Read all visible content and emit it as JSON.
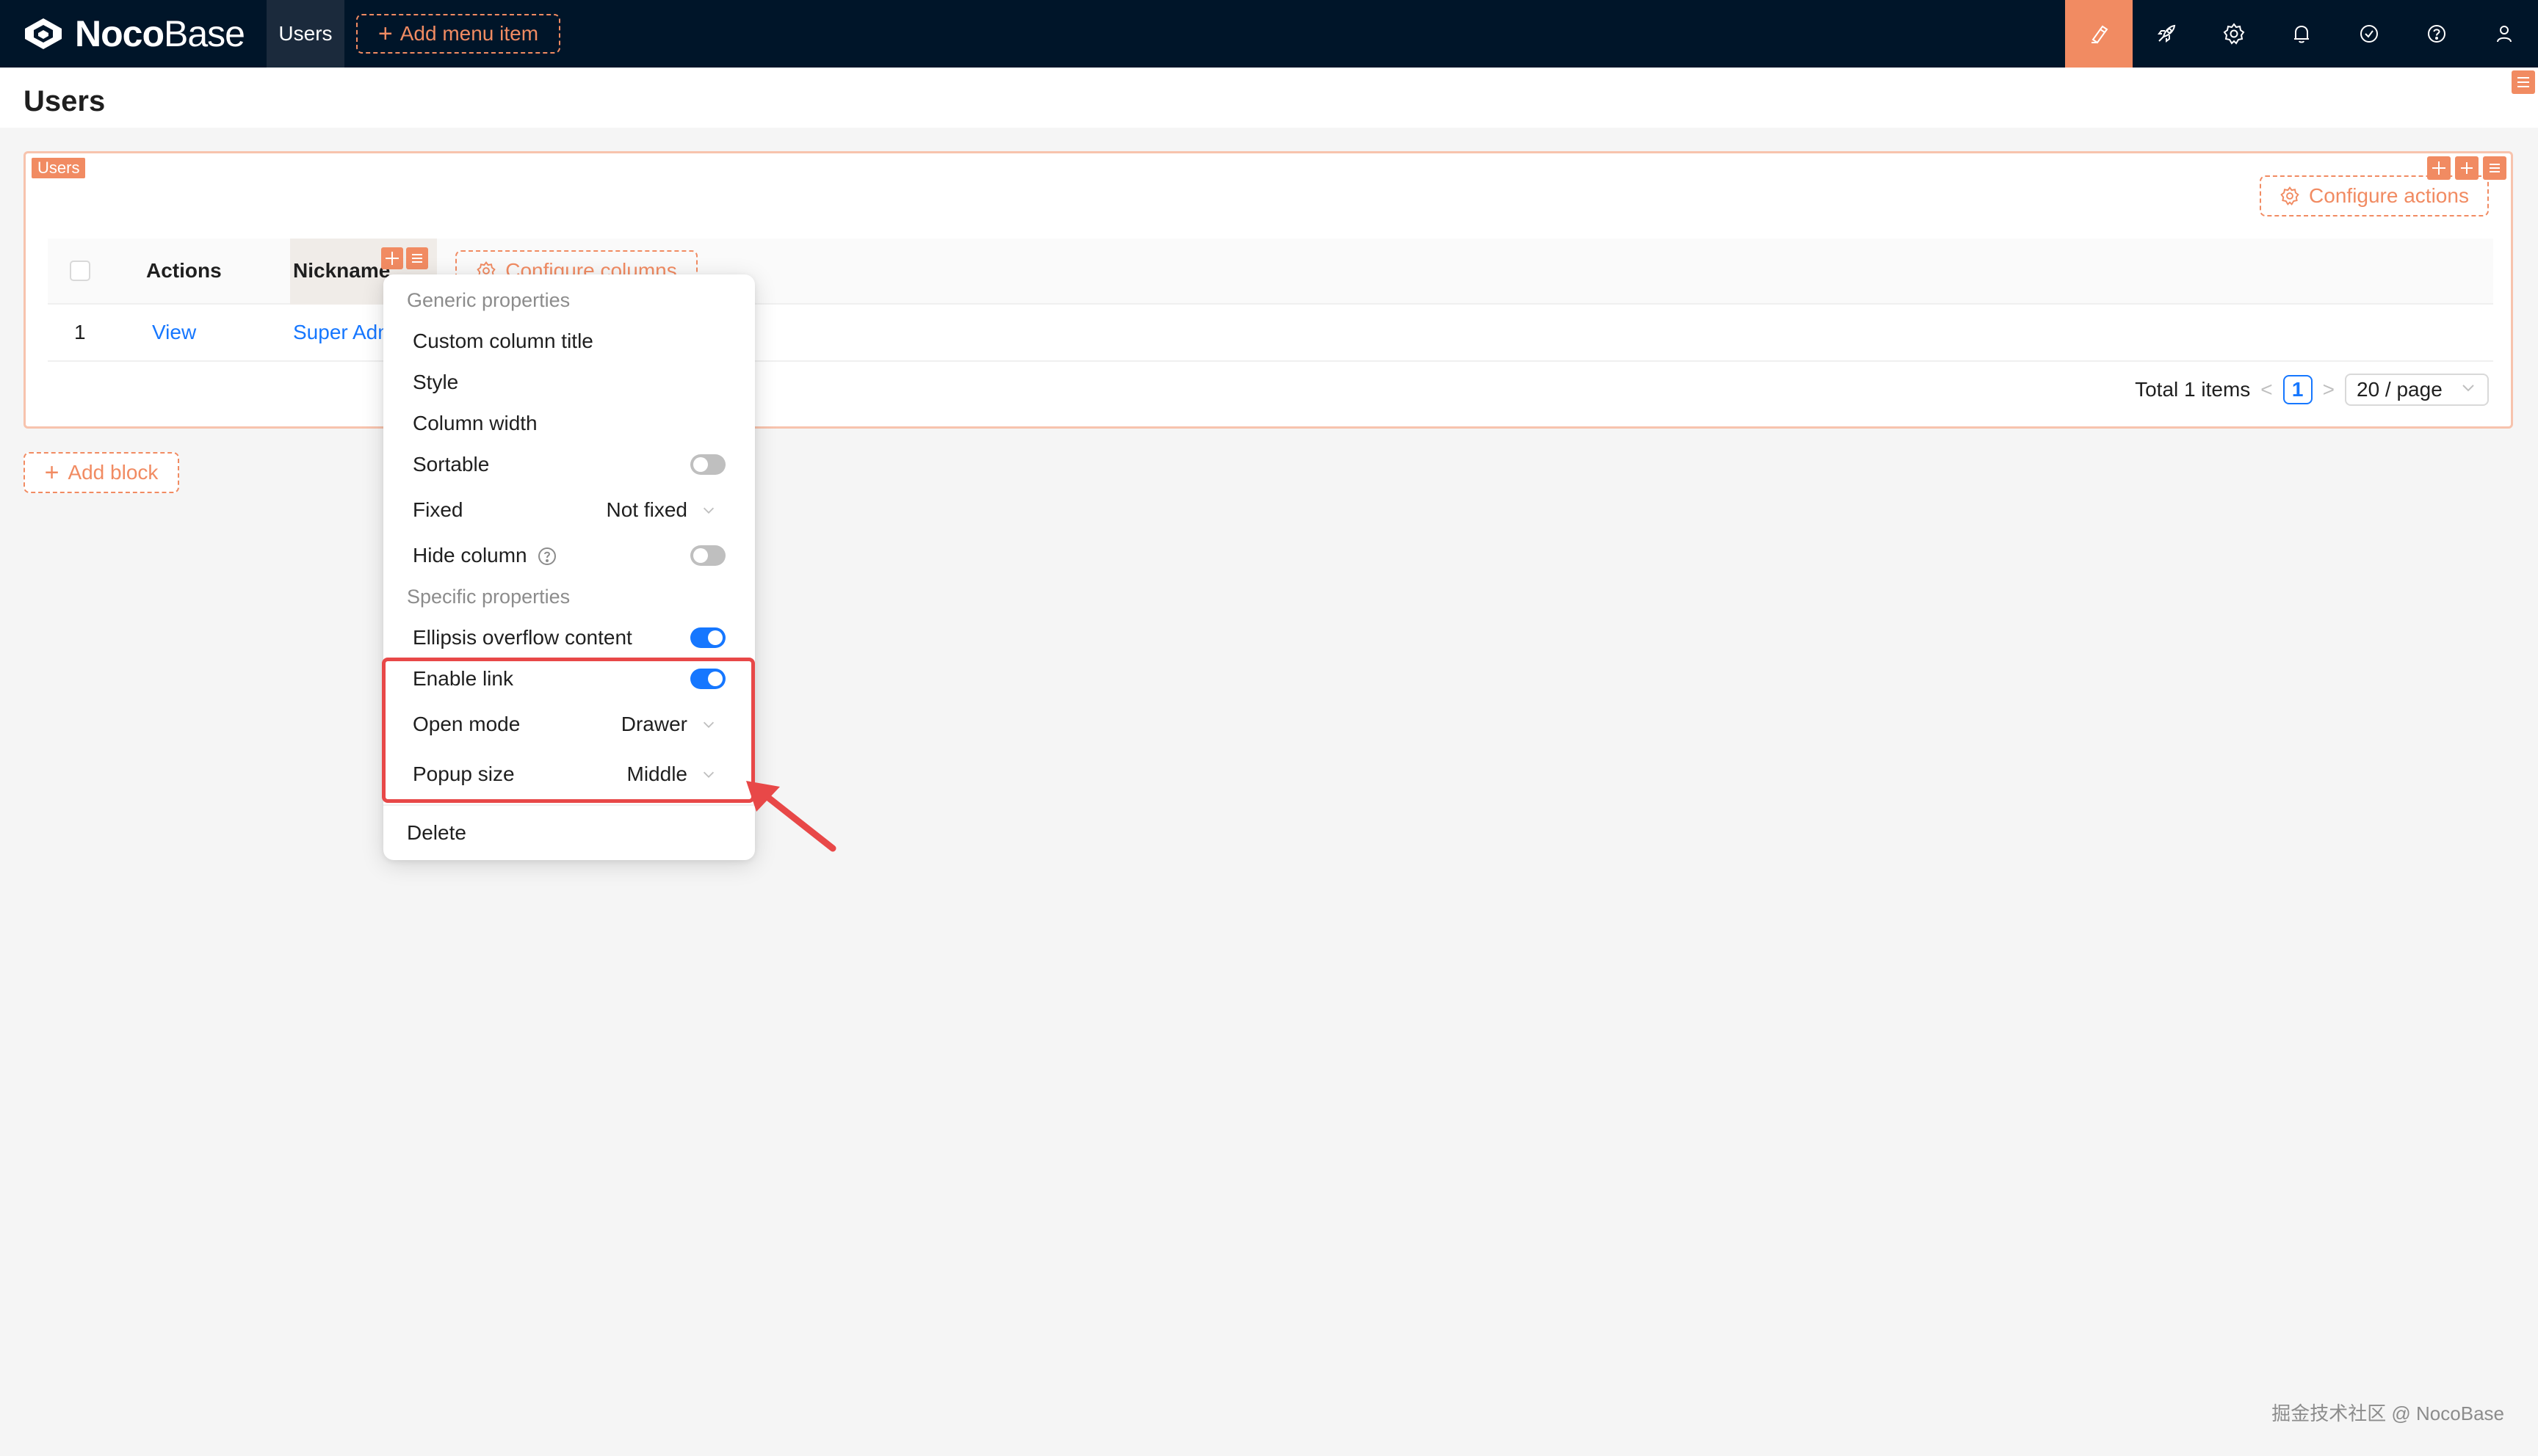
{
  "app": {
    "logo_strong": "Noco",
    "logo_light": "Base",
    "nav_item": "Users",
    "add_menu_item": "Add menu item"
  },
  "topbar_icons": [
    "design-brush-icon",
    "plugin-rocket-icon",
    "settings-gear-icon",
    "notification-bell-icon",
    "task-check-icon",
    "help-question-icon",
    "user-avatar-icon"
  ],
  "page": {
    "title": "Users"
  },
  "block": {
    "tag": "Users",
    "configure_actions": "Configure actions",
    "columns": {
      "actions": "Actions",
      "nickname": "Nickname"
    },
    "configure_columns": "Configure columns",
    "rows": [
      {
        "index": "1",
        "action": "View",
        "nickname": "Super Admir"
      }
    ],
    "pagination": {
      "total": "Total 1 items",
      "prev": "<",
      "current": "1",
      "next": ">",
      "page_size": "20 / page"
    }
  },
  "add_block": "Add block",
  "menu": {
    "generic_header": "Generic properties",
    "custom_title": "Custom column title",
    "style": "Style",
    "column_width": "Column width",
    "sortable": {
      "label": "Sortable",
      "on": false
    },
    "fixed": {
      "label": "Fixed",
      "value": "Not fixed"
    },
    "hide_column": {
      "label": "Hide column",
      "on": false
    },
    "specific_header": "Specific properties",
    "ellipsis": {
      "label": "Ellipsis overflow content",
      "on": true
    },
    "enable_link": {
      "label": "Enable link",
      "on": true
    },
    "open_mode": {
      "label": "Open mode",
      "value": "Drawer"
    },
    "popup_size": {
      "label": "Popup size",
      "value": "Middle"
    },
    "delete": "Delete"
  },
  "colors": {
    "primary": "#1677ff",
    "accent": "#f18b62",
    "topbar": "#001529",
    "highlight": "#e84848"
  },
  "watermark": "掘金技术社区 @ NocoBase"
}
